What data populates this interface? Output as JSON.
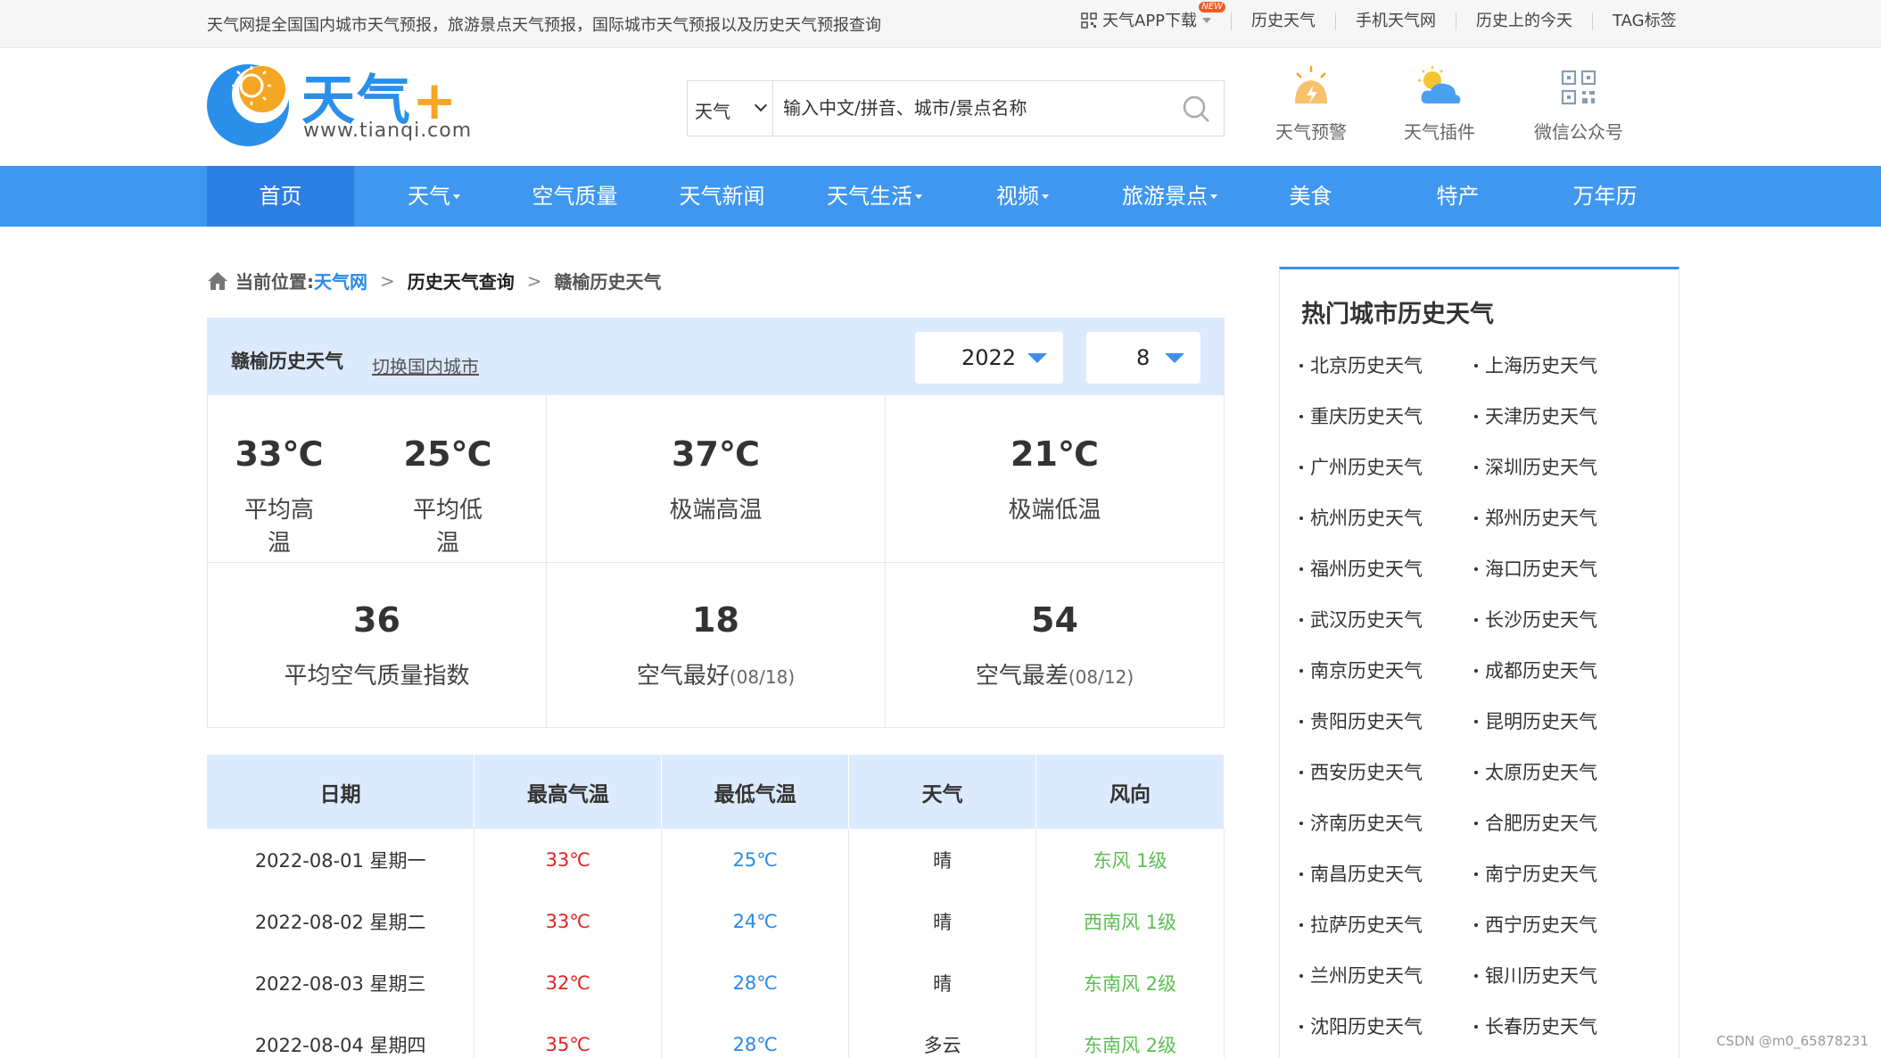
{
  "topbar": {
    "slogan": "天气网提全国国内城市天气预报，旅游景点天气预报，国际城市天气预报以及历史天气预报查询",
    "app_download": "天气APP下载",
    "new_badge": "NEW",
    "history_weather": "历史天气",
    "mobile_weather": "手机天气网",
    "today_in_history": "历史上的今天",
    "tags": "TAG标签"
  },
  "logo": {
    "name": "天气",
    "plus": "+",
    "url": "www.tianqi.com"
  },
  "search": {
    "type_selected": "天气",
    "placeholder": "输入中文/拼音、城市/景点名称"
  },
  "header_icons": [
    {
      "icon": "warning-icon",
      "label": "天气预警"
    },
    {
      "icon": "plugin-icon",
      "label": "天气插件"
    },
    {
      "icon": "wechat-qr-icon",
      "label": "微信公众号"
    }
  ],
  "nav": [
    {
      "label": "首页",
      "active": true,
      "dropdown": false
    },
    {
      "label": "天气",
      "dropdown": true
    },
    {
      "label": "空气质量",
      "dropdown": false
    },
    {
      "label": "天气新闻",
      "dropdown": false
    },
    {
      "label": "天气生活",
      "dropdown": true
    },
    {
      "label": "视频",
      "dropdown": true
    },
    {
      "label": "旅游景点",
      "dropdown": true
    },
    {
      "label": "美食",
      "dropdown": false
    },
    {
      "label": "特产",
      "dropdown": false
    },
    {
      "label": "万年历",
      "dropdown": false
    }
  ],
  "breadcrumb": {
    "prefix": "当前位置:",
    "items": [
      "天气网",
      "历史天气查询",
      "赣榆历史天气"
    ],
    "separator": ">"
  },
  "summary": {
    "title": "赣榆历史天气",
    "switch_city": "切换国内城市",
    "year": "2022",
    "month": "8",
    "avg_high": {
      "value": "33℃",
      "label": "平均高温"
    },
    "avg_low": {
      "value": "25℃",
      "label": "平均低温"
    },
    "extreme_high": {
      "value": "37℃",
      "label": "极端高温"
    },
    "extreme_low": {
      "value": "21℃",
      "label": "极端低温"
    },
    "avg_aqi": {
      "value": "36",
      "label": "平均空气质量指数"
    },
    "best_air": {
      "value": "18",
      "label": "空气最好",
      "date": "(08/18)"
    },
    "worst_air": {
      "value": "54",
      "label": "空气最差",
      "date": "(08/12)"
    }
  },
  "table": {
    "headers": [
      "日期",
      "最高气温",
      "最低气温",
      "天气",
      "风向"
    ],
    "rows": [
      {
        "date": "2022-08-01 星期一",
        "high": "33℃",
        "low": "25℃",
        "weather": "晴",
        "wind": "东风 1级"
      },
      {
        "date": "2022-08-02 星期二",
        "high": "33℃",
        "low": "24℃",
        "weather": "晴",
        "wind": "西南风 1级"
      },
      {
        "date": "2022-08-03 星期三",
        "high": "32℃",
        "low": "28℃",
        "weather": "晴",
        "wind": "东南风 2级"
      },
      {
        "date": "2022-08-04 星期四",
        "high": "35℃",
        "low": "28℃",
        "weather": "多云",
        "wind": "东南风 2级"
      }
    ]
  },
  "sidebar": {
    "title": "热门城市历史天气",
    "cities": [
      "北京历史天气",
      "上海历史天气",
      "重庆历史天气",
      "天津历史天气",
      "广州历史天气",
      "深圳历史天气",
      "杭州历史天气",
      "郑州历史天气",
      "福州历史天气",
      "海口历史天气",
      "武汉历史天气",
      "长沙历史天气",
      "南京历史天气",
      "成都历史天气",
      "贵阳历史天气",
      "昆明历史天气",
      "西安历史天气",
      "太原历史天气",
      "济南历史天气",
      "合肥历史天气",
      "南昌历史天气",
      "南宁历史天气",
      "拉萨历史天气",
      "西宁历史天气",
      "兰州历史天气",
      "银川历史天气",
      "沈阳历史天气",
      "长春历史天气"
    ]
  },
  "watermark": "CSDN @m0_65878231",
  "colors": {
    "nav_blue": "#3f97f0",
    "nav_active": "#2c7ee0",
    "header_bg": "#dceafd",
    "high_temp": "#e02424",
    "low_temp": "#2a8ae4",
    "wind": "#5cbf52",
    "link_blue": "#2b8ae6"
  }
}
